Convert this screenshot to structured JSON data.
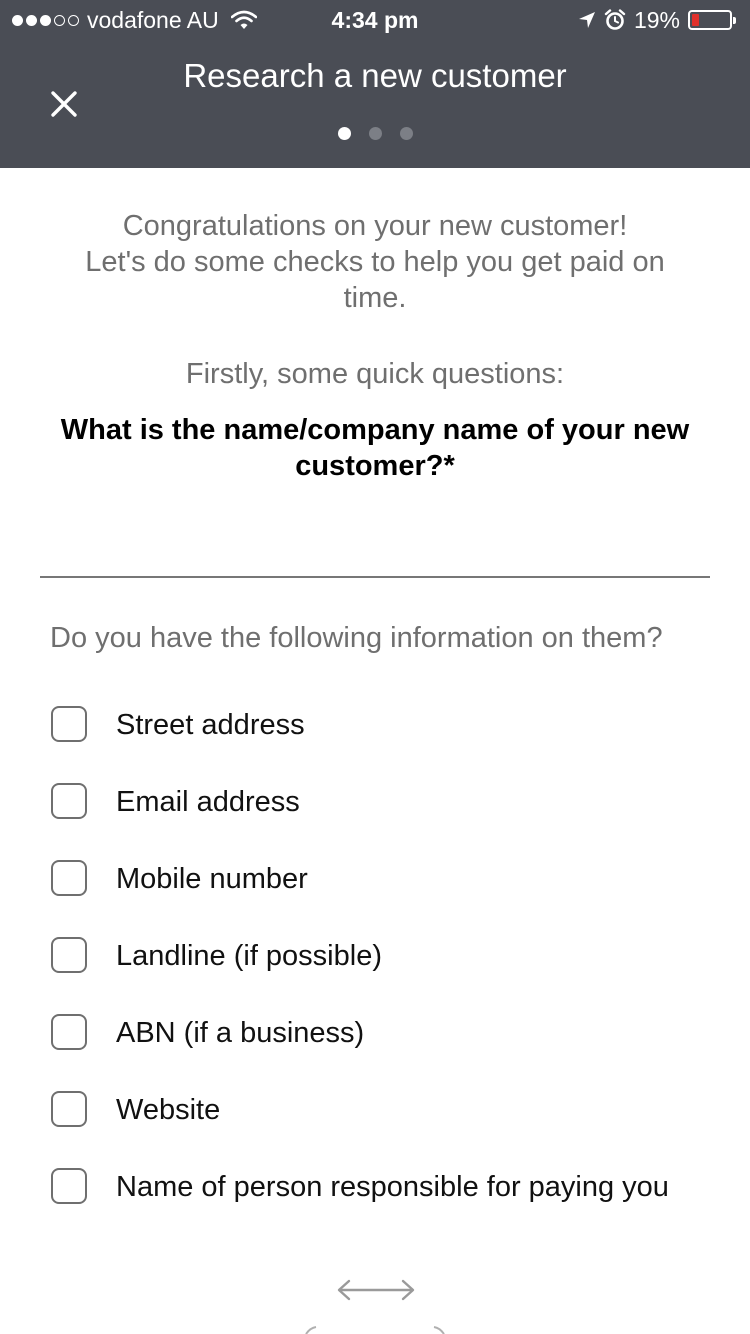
{
  "status_bar": {
    "carrier": "vodafone AU",
    "time": "4:34 pm",
    "battery_percent_text": "19%",
    "battery_level": 0.19,
    "signal_strength": 3,
    "signal_max": 5
  },
  "header": {
    "title": "Research a new customer",
    "page_indicator": {
      "current": 1,
      "total": 3
    }
  },
  "intro": {
    "line1": "Congratulations on your new customer!",
    "line2": "Let's do some checks to help you get paid on time.",
    "sub": "Firstly, some quick questions:"
  },
  "question": {
    "label": "What is the name/company name of your new customer?*",
    "value": "",
    "placeholder": ""
  },
  "info": {
    "prompt": "Do you have the following information on them?",
    "items": [
      {
        "label": "Street address",
        "checked": false
      },
      {
        "label": "Email address",
        "checked": false
      },
      {
        "label": "Mobile number",
        "checked": false
      },
      {
        "label": "Landline (if possible)",
        "checked": false
      },
      {
        "label": "ABN (if a business)",
        "checked": false
      },
      {
        "label": "Website",
        "checked": false
      },
      {
        "label": "Name of person responsible for paying you",
        "checked": false
      }
    ]
  },
  "icons": {
    "close": "close-icon",
    "wifi": "wifi-icon",
    "location": "location-arrow-icon",
    "alarm": "alarm-clock-icon",
    "battery": "battery-icon",
    "swipe": "swipe-left-right-icon"
  },
  "colors": {
    "header_bg": "#4a4d55",
    "battery_low": "#e0302b",
    "muted_text": "#6f6f6f",
    "pager_active": "#ffffff",
    "pager_inactive": "#7c7f86"
  }
}
